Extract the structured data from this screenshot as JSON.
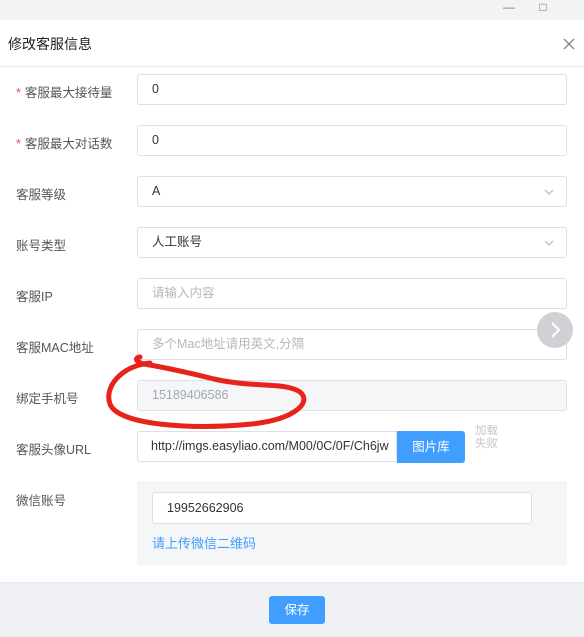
{
  "window": {
    "minimize_glyph": "—",
    "maximize_glyph": "□"
  },
  "dialog": {
    "title": "修改客服信息",
    "close_icon": "close-icon"
  },
  "form": {
    "required_mark": "*",
    "max_reception": {
      "label": "客服最大接待量",
      "value": "0"
    },
    "max_dialogs": {
      "label": "客服最大对话数",
      "value": "0"
    },
    "level": {
      "label": "客服等级",
      "value": "A"
    },
    "account_type": {
      "label": "账号类型",
      "value": "人工账号"
    },
    "ip": {
      "label": "客服IP",
      "placeholder": "请输入内容"
    },
    "mac": {
      "label": "客服MAC地址",
      "placeholder": "多个Mac地址请用英文,分隔"
    },
    "phone": {
      "label": "绑定手机号",
      "value": "15189406586"
    },
    "avatar": {
      "label": "客服头像URL",
      "value": "http://imgs.easyliao.com/M00/0C/0F/Ch6jw",
      "button": "图片库",
      "side_text": "加载 失败"
    },
    "wechat": {
      "label": "微信账号",
      "value": "19952662906",
      "upload_link": "请上传微信二维码"
    }
  },
  "footer": {
    "save_label": "保存"
  },
  "colors": {
    "primary": "#409eff",
    "required": "#e25252",
    "annotation": "#e8231c"
  }
}
